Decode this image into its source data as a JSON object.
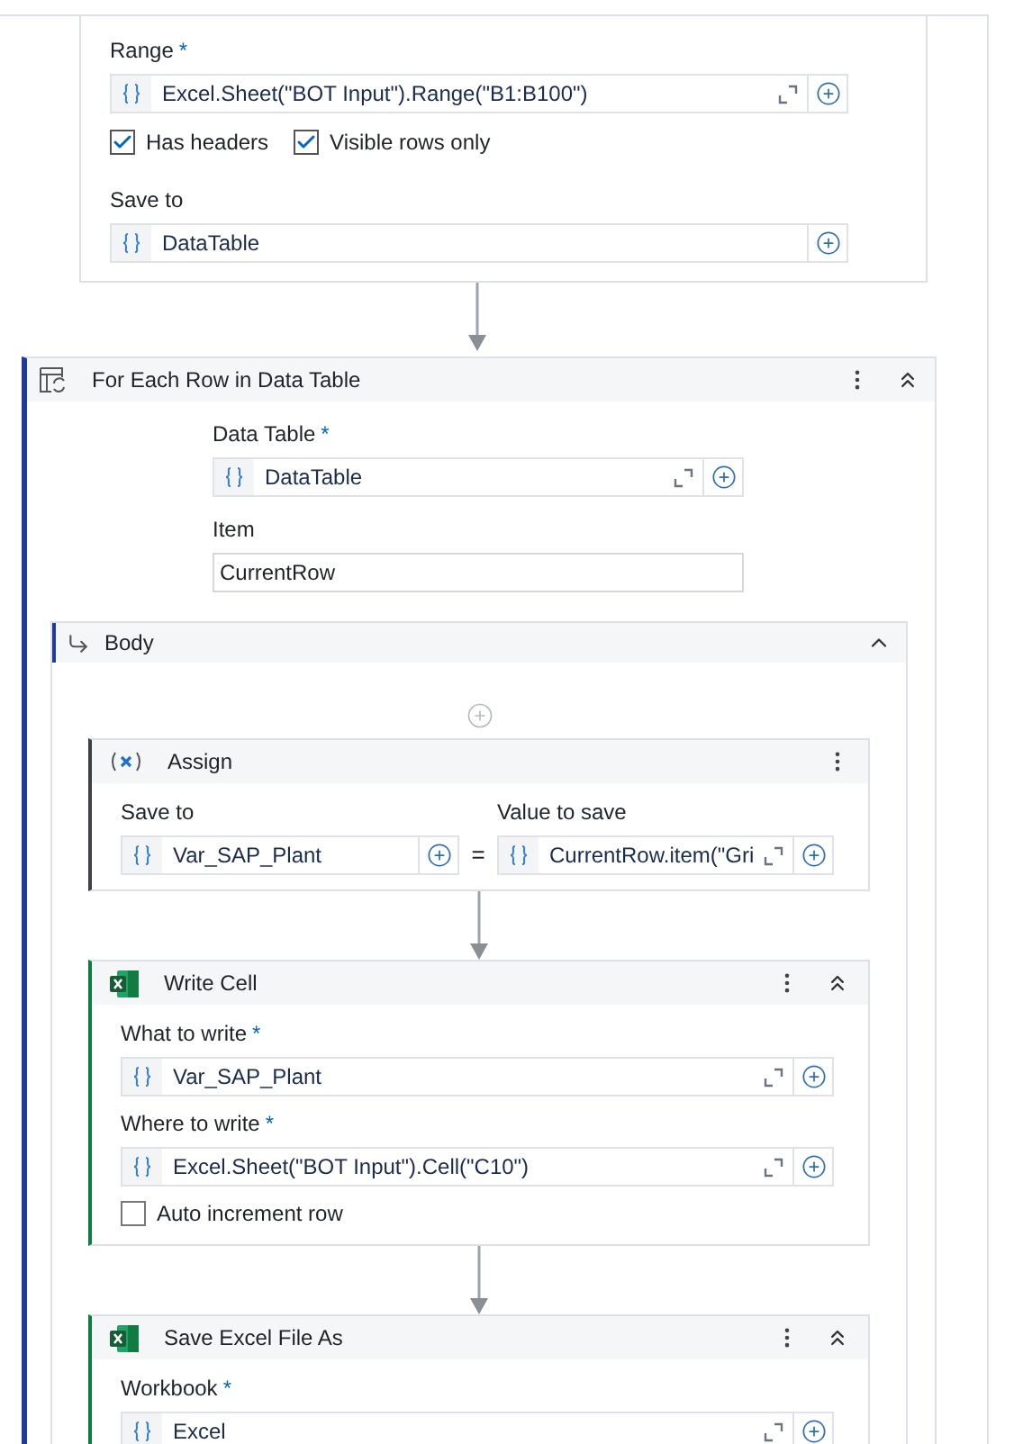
{
  "read_range": {
    "range": {
      "label": "Range",
      "required_mark": "*",
      "value": "Excel.Sheet(\"BOT Input\").Range(\"B1:B100\")",
      "expandable": true
    },
    "options": [
      {
        "label": "Has headers",
        "checked": true
      },
      {
        "label": "Visible rows only",
        "checked": true
      }
    ],
    "save_to": {
      "label": "Save to",
      "value": "DataTable",
      "expandable": false
    }
  },
  "for_each": {
    "title": "For Each Row in Data Table",
    "expanded": true,
    "data_table": {
      "label": "Data Table",
      "required_mark": "*",
      "value": "DataTable",
      "expandable": true
    },
    "item": {
      "label": "Item",
      "value": "CurrentRow"
    },
    "body": {
      "title": "Body",
      "expanded": true,
      "activities": [
        {
          "kind": "assign",
          "title": "Assign",
          "save_to": {
            "label": "Save to",
            "value": "Var_SAP_Plant",
            "expandable": false
          },
          "operator": "=",
          "value_to_save": {
            "label": "Value to save",
            "value": "CurrentRow.item(\"Gri",
            "expandable": true
          }
        },
        {
          "kind": "excel",
          "title": "Write Cell",
          "expanded": true,
          "rows": [
            {
              "kind": "field",
              "label": "What to write",
              "required_mark": "*",
              "value": "Var_SAP_Plant",
              "expandable": true
            },
            {
              "kind": "field",
              "label": "Where to write",
              "required_mark": "*",
              "value": "Excel.Sheet(\"BOT Input\").Cell(\"C10\")",
              "expandable": true
            },
            {
              "kind": "checkbox",
              "label": "Auto increment row",
              "checked": false
            }
          ]
        },
        {
          "kind": "excel",
          "title": "Save Excel File As",
          "expanded": true,
          "rows": [
            {
              "kind": "field",
              "label": "Workbook",
              "required_mark": "*",
              "value": "Excel",
              "expandable": true
            }
          ]
        }
      ]
    }
  }
}
